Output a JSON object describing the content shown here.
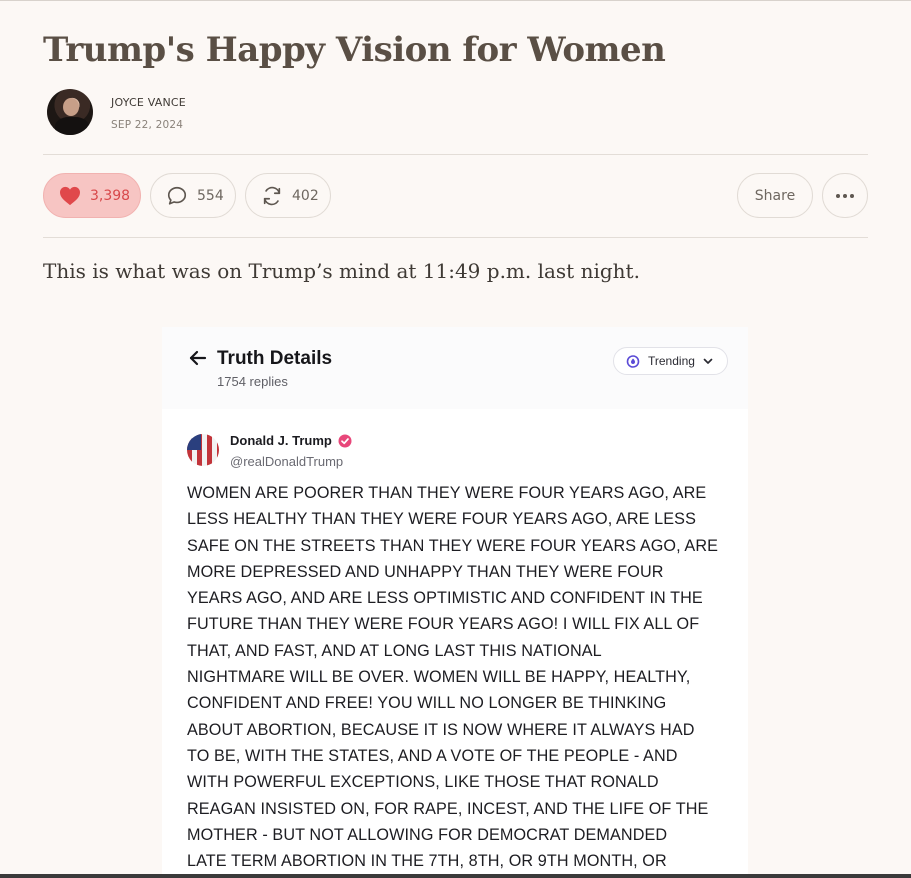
{
  "article": {
    "title": "Trump's Happy Vision for Women",
    "author": "JOYCE VANCE",
    "date": "SEP 22, 2024",
    "lead": "This is what was on Trump’s mind at 11:49 p.m. last night."
  },
  "actions": {
    "likes": "3,398",
    "comments": "554",
    "restacks": "402",
    "share": "Share"
  },
  "embed": {
    "header_title": "Truth Details",
    "replies": "1754 replies",
    "trending": "Trending",
    "poster_name": "Donald J. Trump",
    "poster_handle": "@realDonaldTrump",
    "post_lines": [
      "WOMEN ARE POORER THAN THEY WERE FOUR YEARS AGO, ARE",
      "LESS HEALTHY THAN THEY WERE FOUR YEARS AGO, ARE LESS",
      "SAFE ON THE STREETS THAN THEY WERE FOUR YEARS AGO, ARE",
      "MORE DEPRESSED AND UNHAPPY THAN THEY WERE FOUR",
      "YEARS AGO, AND ARE LESS OPTIMISTIC AND CONFIDENT IN THE",
      "FUTURE THAN THEY WERE FOUR YEARS AGO! I WILL FIX ALL OF",
      "THAT, AND FAST, AND AT LONG LAST THIS NATIONAL",
      "NIGHTMARE WILL BE OVER. WOMEN WILL BE HAPPY, HEALTHY,",
      "CONFIDENT AND FREE! YOU WILL NO LONGER BE THINKING",
      "ABOUT ABORTION, BECAUSE IT IS NOW WHERE IT ALWAYS HAD",
      "TO BE, WITH THE STATES, AND A VOTE OF THE PEOPLE - AND",
      "WITH POWERFUL EXCEPTIONS, LIKE THOSE THAT RONALD",
      "REAGAN INSISTED ON, FOR RAPE, INCEST, AND THE LIFE OF THE",
      "MOTHER - BUT NOT ALLOWING FOR DEMOCRAT DEMANDED",
      "LATE TERM ABORTION IN THE 7TH, 8TH, OR 9TH MONTH, OR"
    ]
  },
  "colors": {
    "page_bg": "#fcf8f5",
    "title": "#5a4f45",
    "like_bg": "#f7c5c3",
    "like_accent": "#d8484a",
    "verified": "#e8477a",
    "trending_icon": "#5b4bd6"
  },
  "icons": {
    "like": "heart-icon",
    "comment": "speech-bubble-icon",
    "restack": "repeat-arrows-icon",
    "more": "ellipsis-icon",
    "back": "arrow-left-icon",
    "trending": "flame-icon",
    "chevron": "chevron-down-icon",
    "verified": "verified-badge-icon"
  }
}
